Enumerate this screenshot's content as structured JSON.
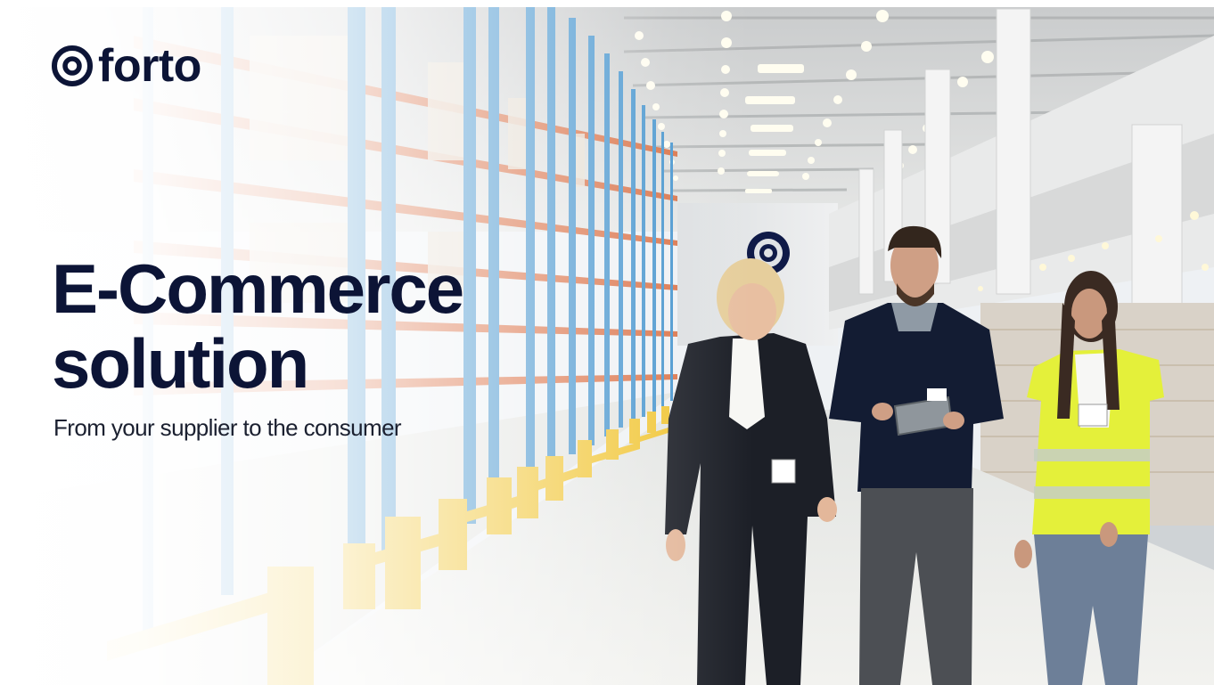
{
  "brand": {
    "logo_text": "forto",
    "colors": {
      "navy": "#0c1436",
      "rack_blue": "#4a97cf",
      "rack_orange": "#d9683a",
      "barrier_yellow": "#f1c637",
      "vest_yellow": "#e4f03a"
    }
  },
  "hero": {
    "headline_line1": "E-Commerce",
    "headline_line2": "solution",
    "subline": "From your supplier to the consumer"
  },
  "icons": {
    "logo_mark": "forto-ring-icon",
    "wall_mark": "forto-wall-logo-icon"
  }
}
